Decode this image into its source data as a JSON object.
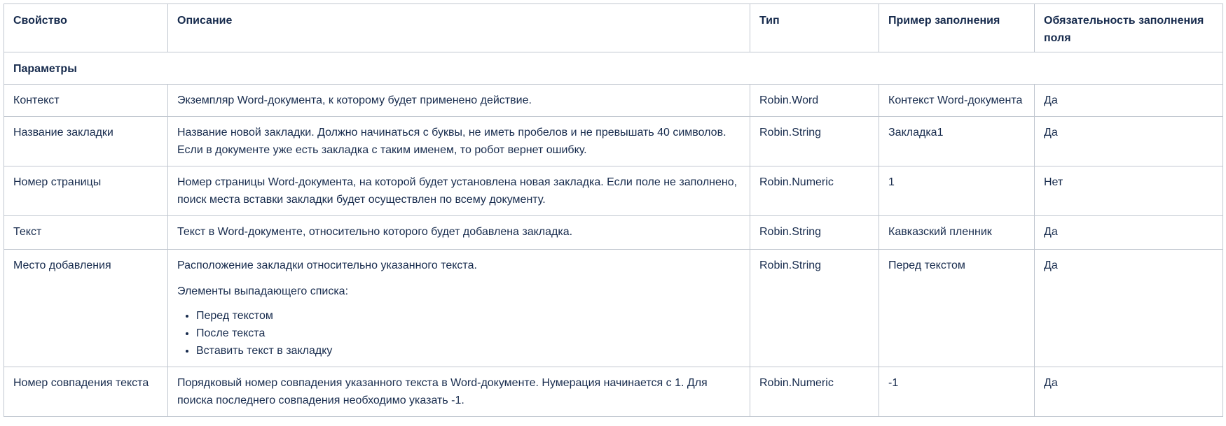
{
  "table": {
    "headers": {
      "property": "Свойство",
      "description": "Описание",
      "type": "Тип",
      "example": "Пример заполнения",
      "required": "Обязательность заполнения поля"
    },
    "section_title": "Параметры",
    "rows": [
      {
        "property": "Контекст",
        "description": "Экземпляр Word-документа, к которому будет применено действие.",
        "type": "Robin.Word",
        "example": "Контекст Word-документа",
        "required": "Да"
      },
      {
        "property": "Название закладки",
        "description": "Название новой закладки. Должно начинаться с буквы, не иметь пробелов и не превышать 40 символов. Если в документе уже есть закладка с таким именем, то робот вернет ошибку.",
        "type": "Robin.String",
        "example": "Закладка1",
        "required": "Да"
      },
      {
        "property": "Номер страницы",
        "description": "Номер страницы Word-документа, на которой будет установлена новая закладка. Если поле не заполнено, поиск места вставки закладки будет осуществлен по всему документу.",
        "type": "Robin.Numeric",
        "example": "1",
        "required": "Нет"
      },
      {
        "property": "Текст",
        "description": "Текст в Word-документе, относительно которого будет добавлена закладка.",
        "type": "Robin.String",
        "example": "Кавказский пленник",
        "required": "Да"
      },
      {
        "property": "Место добавления",
        "description": "Расположение закладки относительно указанного текста.",
        "description_extra": "Элементы выпадающего списка:",
        "options": [
          "Перед текстом",
          "После текста",
          "Вставить текст в закладку"
        ],
        "type": "Robin.String",
        "example": "Перед текстом",
        "required": "Да"
      },
      {
        "property": "Номер совпадения текста",
        "description": "Порядковый номер совпадения указанного текста в Word-документе. Нумерация начинается с 1. Для поиска последнего совпадения необходимо указать -1.",
        "type": "Robin.Numeric",
        "example": "-1",
        "required": "Да"
      }
    ]
  }
}
